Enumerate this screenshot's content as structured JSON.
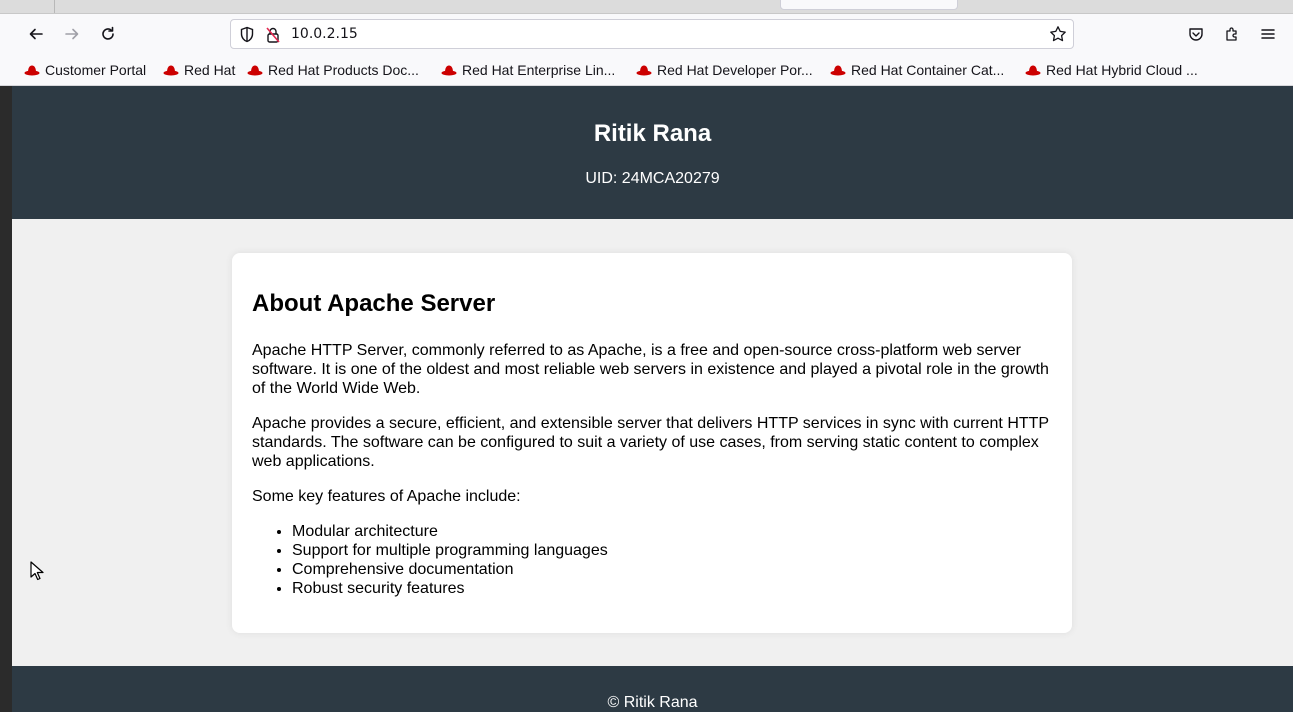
{
  "browser": {
    "url": "10.0.2.15",
    "bookmarks": [
      {
        "label": "Customer Portal"
      },
      {
        "label": "Red Hat"
      },
      {
        "label": "Red Hat Products Doc..."
      },
      {
        "label": "Red Hat Enterprise Lin..."
      },
      {
        "label": "Red Hat Developer Por..."
      },
      {
        "label": "Red Hat Container Cat..."
      },
      {
        "label": "Red Hat Hybrid Cloud ..."
      }
    ]
  },
  "header": {
    "name": "Ritik Rana",
    "uid": "UID: 24MCA20279"
  },
  "card": {
    "title": "About Apache Server",
    "paragraphs": [
      "Apache HTTP Server, commonly referred to as Apache, is a free and open-source cross-platform web server software. It is one of the oldest and most reliable web servers in existence and played a pivotal role in the growth of the World Wide Web.",
      "Apache provides a secure, efficient, and extensible server that delivers HTTP services in sync with current HTTP standards. The software can be configured to suit a variety of use cases, from serving static content to complex web applications.",
      "Some key features of Apache include:"
    ],
    "features": [
      "Modular architecture",
      "Support for multiple programming languages",
      "Comprehensive documentation",
      "Robust security features"
    ]
  },
  "footer": {
    "text": "© Ritik Rana"
  },
  "colors": {
    "header_bg": "#2d3a44",
    "page_bg": "#f0f0f0",
    "card_bg": "#ffffff",
    "redhat": "#cc0000"
  }
}
